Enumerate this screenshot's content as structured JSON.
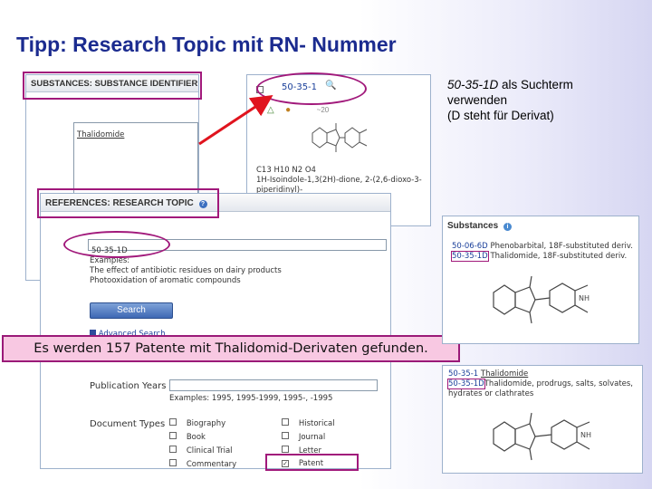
{
  "slide": {
    "title": "Tipp: Research Topic mit RN- Nummer",
    "note_line1_term": "50-35-1D",
    "note_line1_rest": "  als Suchterm",
    "note_line2": "verwenden",
    "note_line3": "(D steht für Derivat)",
    "callout": "Es werden 157 Patente mit Thalidomid-Derivaten gefunden."
  },
  "substance_identifier_panel": {
    "header": "SUBSTANCES: SUBSTANCE IDENTIFIER",
    "input_value": "Thalidomide"
  },
  "substance_record": {
    "rn": "50-35-1",
    "formula": "C13 H10 N2 O4",
    "name_line1": "1H-Isoindole-1,3(2H)-dione, 2-(2,6-dioxo-3-",
    "name_line2": "piperidinyl)-"
  },
  "research_topic_panel": {
    "header": "REFERENCES: RESEARCH TOPIC",
    "input_value": "50-35-1D",
    "examples_label": "Examples:",
    "example1": "The effect of antibiotic residues on dairy products",
    "example2": "Photooxidation of aromatic compounds",
    "search_label": "Search",
    "advanced_label": "Advanced Search",
    "pub_years_label": "Publication Years",
    "pub_years_examples": "Examples: 1995, 1995-1999, 1995-, -1995",
    "doc_types_label": "Document Types",
    "doc_types": [
      {
        "label": "Biography",
        "checked": false
      },
      {
        "label": "Book",
        "checked": false
      },
      {
        "label": "Clinical Trial",
        "checked": false
      },
      {
        "label": "Commentary",
        "checked": false
      }
    ],
    "doc_types_right": [
      {
        "label": "Historical",
        "checked": false
      },
      {
        "label": "Journal",
        "checked": false
      },
      {
        "label": "Letter",
        "checked": false
      },
      {
        "label": "Patent",
        "checked": true
      }
    ]
  },
  "substances_panel_1": {
    "header": "Substances",
    "row1_rn": "50-06-6D",
    "row1_text": "Phenobarbital, 18F-substituted deriv.",
    "row2_rn": "50-35-1D",
    "row2_text": "Thalidomide, 18F-substituted deriv."
  },
  "substances_panel_2": {
    "row1_rn": "50-35-1",
    "row1_text": "Thalidomide",
    "row2_rn": "50-35-1D",
    "row2_text": "Thalidomide, prodrugs, salts, solvates,",
    "row2_text_cont": "hydrates or clathrates"
  },
  "colors": {
    "title": "#1b2b8f",
    "highlight": "#a1197b",
    "arrow": "#e0141e",
    "link": "#1a3f9a"
  }
}
